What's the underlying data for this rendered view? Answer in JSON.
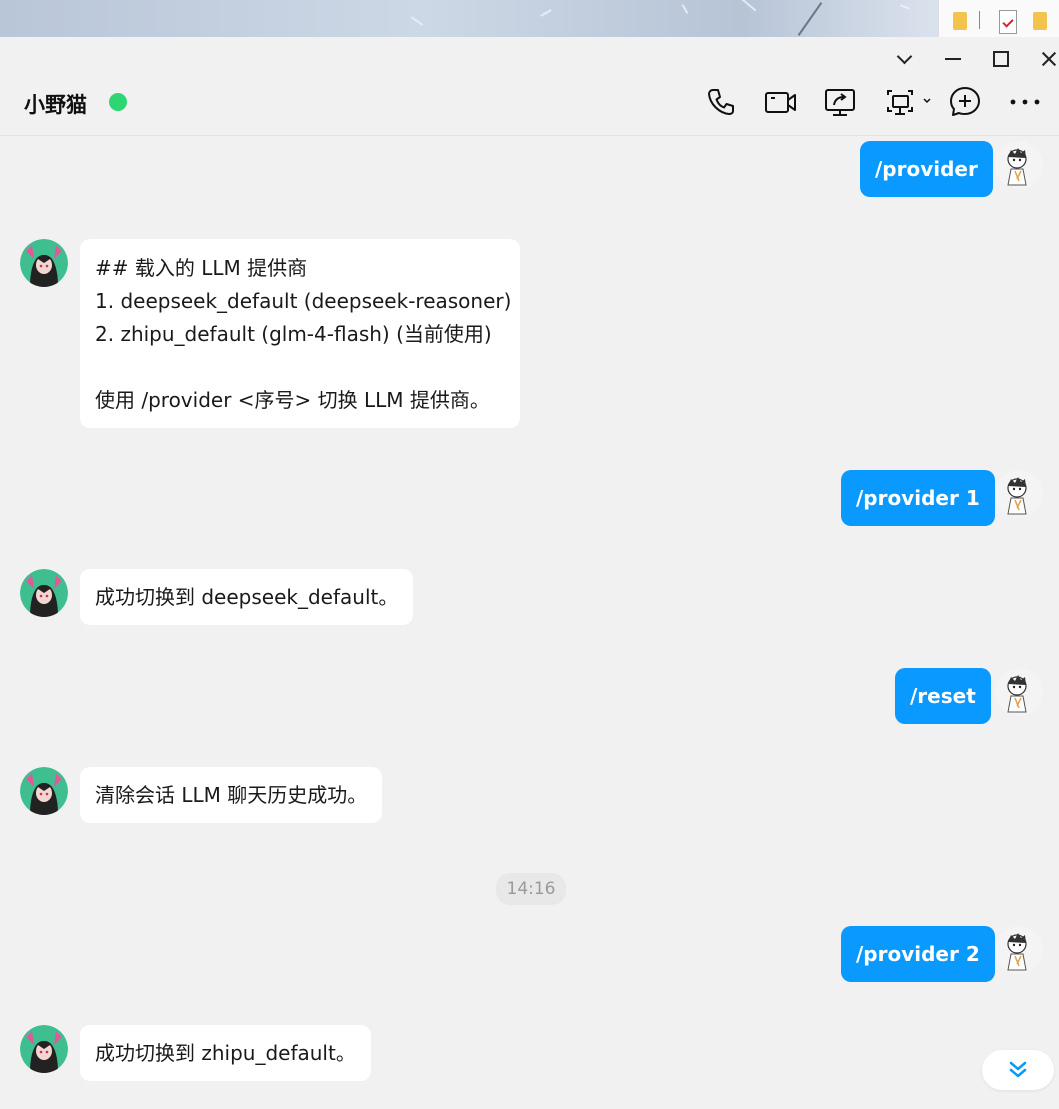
{
  "window": {
    "title": "小野猫",
    "online_status_color": "#2ed573"
  },
  "header_icons": [
    "phone-icon",
    "video-call-icon",
    "screen-share-icon",
    "remote-control-icon",
    "add-chat-icon",
    "more-icon"
  ],
  "messages": [
    {
      "sender": "me",
      "text": "/provider"
    },
    {
      "sender": "bot",
      "text": "## 载入的 LLM 提供商\n1. deepseek_default (deepseek-reasoner)\n2. zhipu_default (glm-4-flash) (当前使用)\n\n使用 /provider <序号> 切换 LLM 提供商。"
    },
    {
      "sender": "me",
      "text": "/provider 1"
    },
    {
      "sender": "bot",
      "text": "成功切换到 deepseek_default。"
    },
    {
      "sender": "me",
      "text": "/reset"
    },
    {
      "sender": "bot",
      "text": "清除会话 LLM 聊天历史成功。"
    },
    {
      "sender": "me",
      "text": "/provider 2"
    },
    {
      "sender": "bot",
      "text": "成功切换到 zhipu_default。"
    }
  ],
  "timestamp": "14:16",
  "colors": {
    "outgoing_bubble": "#0a99ff",
    "incoming_bubble": "#ffffff",
    "background": "#f1f1f1"
  }
}
